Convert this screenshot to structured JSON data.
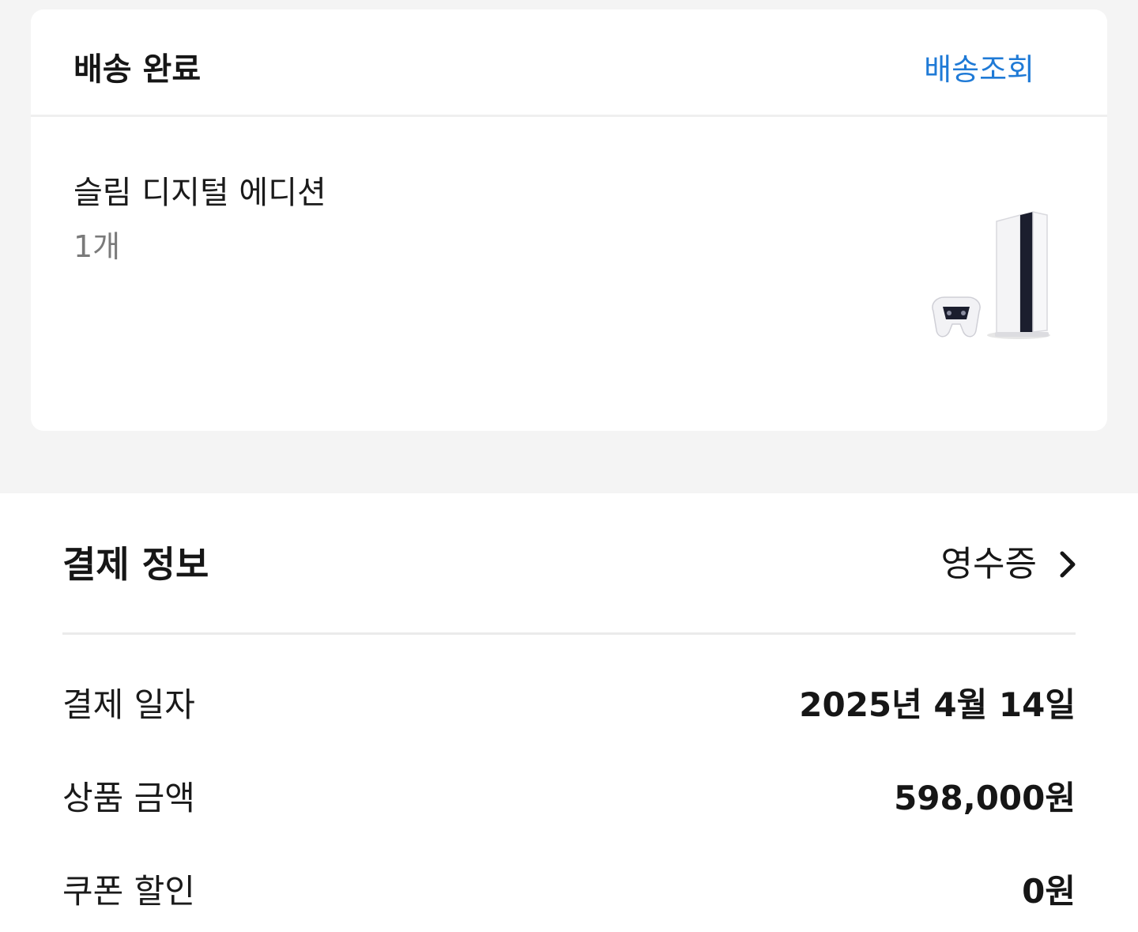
{
  "delivery": {
    "status": "배송 완료",
    "track_label": "배송조회",
    "accent_color": "#1f7ad6"
  },
  "product": {
    "name": "슬림 디지털 에디션",
    "quantity": "1개",
    "image_icon": "console-and-controller-image"
  },
  "payment": {
    "title": "결제 정보",
    "receipt_label": "영수증",
    "receipt_icon": "chevron-right-icon",
    "rows": [
      {
        "label": "결제 일자",
        "value": "2025년 4월 14일"
      },
      {
        "label": "상품 금액",
        "value": "598,000원"
      },
      {
        "label": "쿠폰 할인",
        "value": "0원"
      }
    ]
  }
}
